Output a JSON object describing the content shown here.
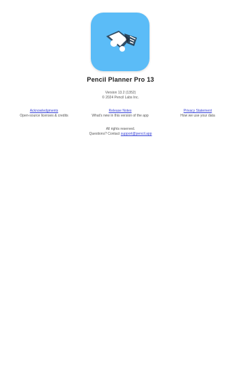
{
  "app": {
    "icon_name": "paint-brush-app-icon",
    "icon_color": "#5bbcf7",
    "title": "Pencil Planner Pro 13"
  },
  "header": {
    "version": "Version 13.2 (1352)",
    "copyright": "© 2024 Pencil Labs Inc."
  },
  "links": [
    {
      "label": "Acknowledgments",
      "desc": "Open-source licenses & credits"
    },
    {
      "label": "Release Notes",
      "desc": "What's new in this version of the app"
    },
    {
      "label": "Privacy Statement",
      "desc": "How we use your data"
    }
  ],
  "footer": {
    "line1": "All rights reserved.",
    "line2_prefix": "Questions? Contact",
    "line2_link": "support@pencil.app"
  },
  "colors": {
    "link": "#3b45d8",
    "background": "#ffffff"
  }
}
